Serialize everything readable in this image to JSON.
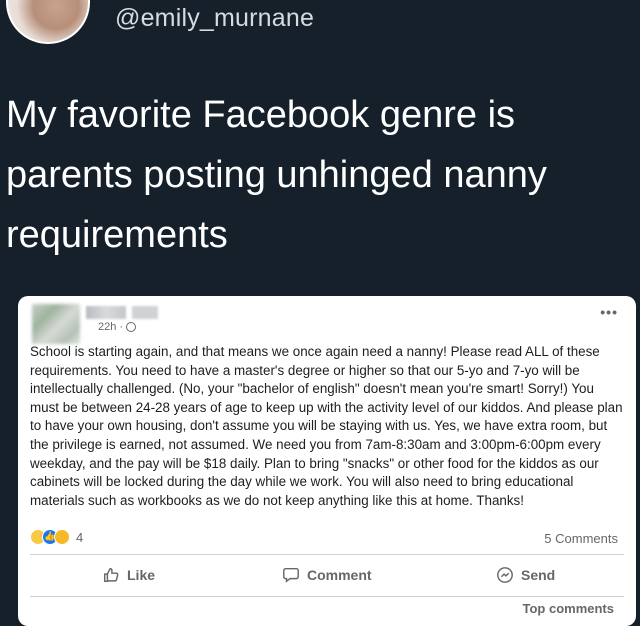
{
  "tweet": {
    "handle": "@emily_murnane",
    "text": "My favorite Facebook genre is parents posting unhinged nanny requirements"
  },
  "facebook_post": {
    "timestamp": "22h",
    "separator": "·",
    "more": "•••",
    "body": "School is starting again, and that means we once again need a nanny! Please read ALL of these requirements. You need to have a master's degree or higher so that our 5-yo and 7-yo will be intellectually challenged. (No, your \"bachelor of english\" doesn't mean you're smart! Sorry!) You must be between 24-28 years of age to keep up with the activity level of our kiddos. And please plan to have your own housing, don't assume you will be staying with us. Yes, we have extra room, but the privilege is earned, not assumed. We need you from 7am-8:30am and 3:00pm-6:00pm every weekday, and the pay will be $18 daily. Plan to bring \"snacks\" or other food for the kiddos as our cabinets will be locked during the day while we work. You will also need to bring educational materials such as workbooks as we do not keep anything like this at home. Thanks!",
    "reaction_count": "4",
    "comments_count": "5 Comments",
    "actions": {
      "like": "Like",
      "comment": "Comment",
      "send": "Send"
    },
    "top_comments": "Top comments"
  }
}
